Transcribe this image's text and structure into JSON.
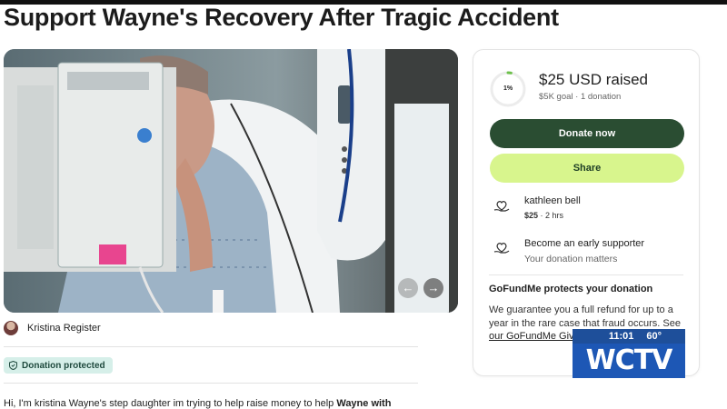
{
  "page": {
    "title": "Support Wayne's Recovery After Tragic Accident"
  },
  "organizer": {
    "name": "Kristina Register"
  },
  "badge": {
    "label": "Donation protected"
  },
  "story": {
    "preview_prefix": "Hi, I'm kristina Wayne's step daughter im trying to help raise money to help ",
    "preview_bold": "Wayne with"
  },
  "donation_card": {
    "progress_percent": 1,
    "progress_label": "1%",
    "raised": "$25 USD raised",
    "goal": "$5K goal",
    "separator": "·",
    "donations": "1 donation",
    "donate_label": "Donate now",
    "share_label": "Share",
    "recent_donor": {
      "name": "kathleen bell",
      "amount": "$25",
      "time": "· 2 hrs"
    },
    "early_supporter": {
      "title": "Become an early supporter",
      "subtitle": "Your donation matters"
    },
    "protection": {
      "title": "GoFundMe protects your donation",
      "text": "We guarantee you a full refund for up to a year in the rare case that fraud occurs. See",
      "link": "our GoFundMe Giv"
    }
  },
  "tv_bug": {
    "time": "11:01",
    "temp": "60°",
    "logo": "WCTV"
  },
  "colors": {
    "donate_button": "#2a4d32",
    "share_button": "#d8f58d",
    "badge_bg": "#d6efe9",
    "progress_accent": "#6cc04a",
    "tv_blue": "#1d57b5"
  },
  "icons": {
    "carousel_prev": "arrow-left-icon",
    "carousel_next": "arrow-right-icon",
    "badge": "shield-icon",
    "donor": "heart-hand-icon"
  }
}
